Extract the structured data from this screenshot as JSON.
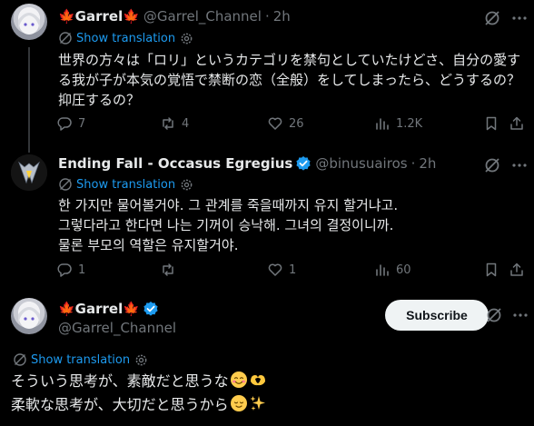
{
  "tweet1": {
    "name": "🍁Garrel🍁",
    "handle": "@Garrel_Channel",
    "dot": "·",
    "time": "2h",
    "show_translation": "Show translation",
    "lines": [
      "世界の方々は「ロリ」というカテゴリを禁句としていたけどさ、自分の愛す",
      "る我が子が本気の覚悟で禁断の恋（全般）をしてしまったら、どうするの？",
      "抑圧するの？"
    ],
    "replies": "7",
    "reposts": "4",
    "likes": "26",
    "views": "1.2K"
  },
  "tweet2": {
    "name": "Ending Fall - Occasus Egregius",
    "handle": "@binusuairos",
    "dot": "·",
    "time": "2h",
    "show_translation": "Show translation",
    "lines": [
      "한 가지만 물어볼거야. 그 관계를 죽을때까지 유지 할거냐고.",
      "그렇다라고 한다면 나는 기꺼이 승낙해. 그녀의 결정이니까.",
      "물론 부모의 역할은 유지할거야."
    ],
    "replies": "1",
    "reposts": "",
    "likes": "1",
    "views": "60"
  },
  "tweet3": {
    "name": "🍁Garrel🍁",
    "handle": "@Garrel_Channel",
    "subscribe_label": "Subscribe",
    "show_translation": "Show translation",
    "lines": [
      "そういう思考が、素敵だと思うな",
      "柔軟な思考が、大切だと思うから"
    ]
  },
  "colors": {
    "background": "#000000",
    "text": "#e7e9ea",
    "muted": "#71767b",
    "accent": "#1d9bf0",
    "maple": "#e0245e"
  },
  "icons": [
    "grok-icon",
    "more-icon",
    "translate-icon",
    "gear-icon",
    "reply-icon",
    "repost-icon",
    "like-icon",
    "views-icon",
    "bookmark-icon",
    "share-icon",
    "verified-icon",
    "smiling-face-emoji",
    "heart-hands-emoji",
    "sparkles-emoji"
  ]
}
